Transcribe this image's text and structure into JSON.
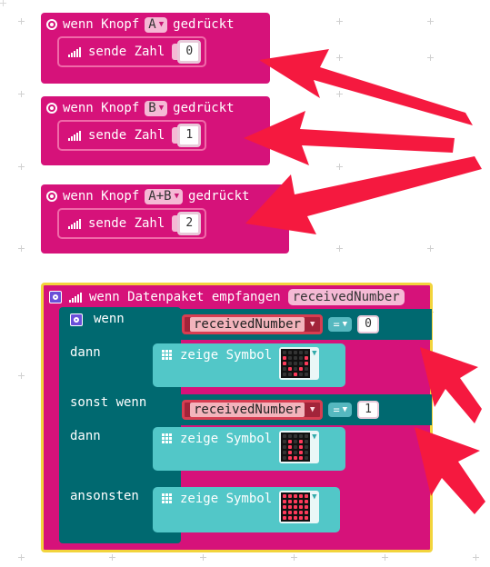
{
  "button_events": [
    {
      "prefix": "wenn Knopf",
      "button": "A",
      "suffix": "gedrückt",
      "action": "sende Zahl",
      "value": "0"
    },
    {
      "prefix": "wenn Knopf",
      "button": "B",
      "suffix": "gedrückt",
      "action": "sende Zahl",
      "value": "1"
    },
    {
      "prefix": "wenn Knopf",
      "button": "A+B",
      "suffix": "gedrückt",
      "action": "sende Zahl",
      "value": "2"
    }
  ],
  "radio_event": {
    "title": "wenn Datenpaket empfangen",
    "param": "receivedNumber"
  },
  "if_block": {
    "if_label": "wenn",
    "then_label": "dann",
    "elseif_label": "sonst wenn",
    "else_label": "ansonsten",
    "show_label": "zeige Symbol",
    "conditions": [
      {
        "variable": "receivedNumber",
        "operator": "=",
        "value": "0"
      },
      {
        "variable": "receivedNumber",
        "operator": "=",
        "value": "1"
      }
    ]
  },
  "colors": {
    "event": "#d6127a",
    "logic": "#006970",
    "display": "#52c7c8",
    "arrow": "#f5193f",
    "highlight": "#f2d43c"
  },
  "icons": [
    "gear-icon",
    "signal-icon",
    "settings-icon",
    "grid-icon",
    "led-matrix",
    "arrow"
  ]
}
